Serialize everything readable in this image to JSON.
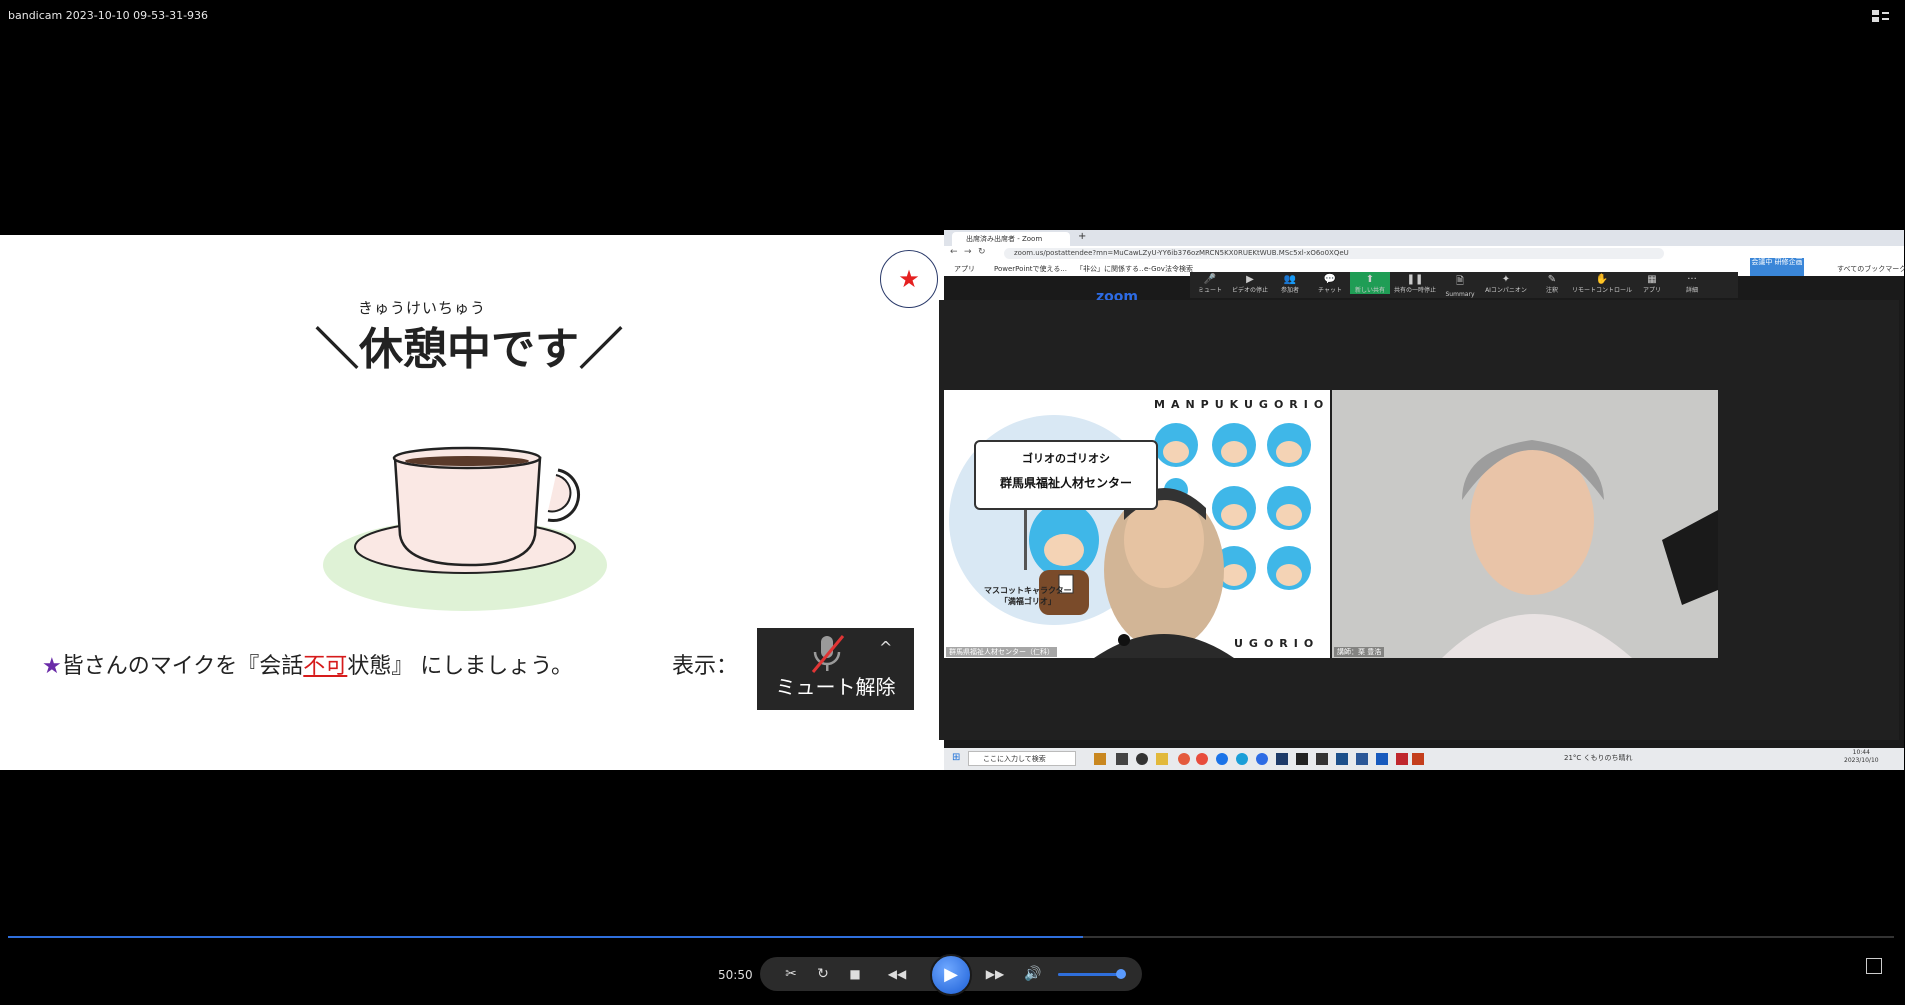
{
  "recorder": {
    "title": "bandicam 2023-10-10 09-53-31-936"
  },
  "slide": {
    "furigana": "きゅうけいちゅう",
    "title": "＼休憩中です／",
    "star_badge": "★",
    "instruction_star": "★",
    "instruction_pre": "皆さんのマイクを『会話",
    "instruction_red": "不可",
    "instruction_post": "状態』 にしましょう。",
    "display_label": "表示：",
    "unmute_label": "ミュート解除",
    "unmute_caret": "^"
  },
  "zoom": {
    "tab_title": "出席済み出席者 - Zoom",
    "new_tab": "+",
    "url": "zoom.us/postattendee?mn=MuCawLZyU-YY6ib376ozMRCN5KX0RUEKtWUB.MSc5xl-xO6o0XQeU",
    "bookmarks": [
      "アプリ",
      "PowerPointで使える...",
      "「非公」に関係する..",
      "e-Gov法令検索",
      "すべてのブックマーク"
    ],
    "toolbar": [
      "ミュート",
      "ビデオの停止",
      "参加者",
      "チャット",
      "新しい共有",
      "共有の一時停止",
      "Summary",
      "AIコンパニオン",
      "注釈",
      "リモートコントロール",
      "アプリ",
      "詳細"
    ],
    "toolbar_icons": [
      "🎤",
      "▶",
      "👥",
      "💬",
      "⬆",
      "❚❚",
      "🗎",
      "✦",
      "✎",
      "✋",
      "▦",
      "···"
    ],
    "logo": "zoom",
    "badge": "会議中 研修企画",
    "video1": {
      "banner": "MANPUKUGORIO",
      "banner_bottom": "UGORIO",
      "sign_line1": "ゴリオのゴリオシ",
      "sign_line2": "群馬県福祉人材センター",
      "mascot_caption_1": "マスコットキャラクター",
      "mascot_caption_2": "「満福ゴリオ」",
      "name": "群馬県福祉人材センター（仁科）"
    },
    "video2": {
      "name": "講師：栗 豊浩"
    },
    "taskbar": {
      "search_placeholder": "ここに入力して検索",
      "weather": "21°C くもりのち晴れ",
      "clock_time": "10:44",
      "clock_date": "2023/10/10"
    }
  },
  "player": {
    "time": "50:50",
    "progress": 0.57,
    "volume": 1.0,
    "buttons": {
      "trim": "✂",
      "repeat": "↻",
      "stop": "■",
      "rewind": "◀◀",
      "play": "▶",
      "forward": "▶▶",
      "volume": "🔊"
    }
  },
  "colors": {
    "accent": "#2f6fdc",
    "instruction_red": "#d61b1b",
    "star_purple": "#6a2ba8"
  }
}
